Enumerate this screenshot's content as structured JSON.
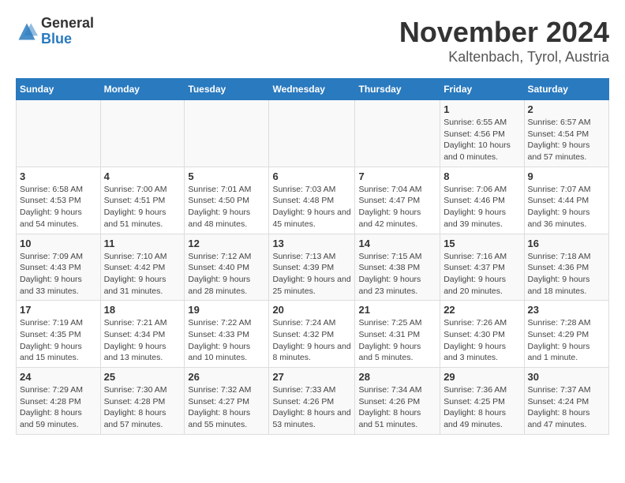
{
  "header": {
    "logo_general": "General",
    "logo_blue": "Blue",
    "month_title": "November 2024",
    "location": "Kaltenbach, Tyrol, Austria"
  },
  "weekdays": [
    "Sunday",
    "Monday",
    "Tuesday",
    "Wednesday",
    "Thursday",
    "Friday",
    "Saturday"
  ],
  "weeks": [
    [
      {
        "day": "",
        "info": ""
      },
      {
        "day": "",
        "info": ""
      },
      {
        "day": "",
        "info": ""
      },
      {
        "day": "",
        "info": ""
      },
      {
        "day": "",
        "info": ""
      },
      {
        "day": "1",
        "info": "Sunrise: 6:55 AM\nSunset: 4:56 PM\nDaylight: 10 hours and 0 minutes."
      },
      {
        "day": "2",
        "info": "Sunrise: 6:57 AM\nSunset: 4:54 PM\nDaylight: 9 hours and 57 minutes."
      }
    ],
    [
      {
        "day": "3",
        "info": "Sunrise: 6:58 AM\nSunset: 4:53 PM\nDaylight: 9 hours and 54 minutes."
      },
      {
        "day": "4",
        "info": "Sunrise: 7:00 AM\nSunset: 4:51 PM\nDaylight: 9 hours and 51 minutes."
      },
      {
        "day": "5",
        "info": "Sunrise: 7:01 AM\nSunset: 4:50 PM\nDaylight: 9 hours and 48 minutes."
      },
      {
        "day": "6",
        "info": "Sunrise: 7:03 AM\nSunset: 4:48 PM\nDaylight: 9 hours and 45 minutes."
      },
      {
        "day": "7",
        "info": "Sunrise: 7:04 AM\nSunset: 4:47 PM\nDaylight: 9 hours and 42 minutes."
      },
      {
        "day": "8",
        "info": "Sunrise: 7:06 AM\nSunset: 4:46 PM\nDaylight: 9 hours and 39 minutes."
      },
      {
        "day": "9",
        "info": "Sunrise: 7:07 AM\nSunset: 4:44 PM\nDaylight: 9 hours and 36 minutes."
      }
    ],
    [
      {
        "day": "10",
        "info": "Sunrise: 7:09 AM\nSunset: 4:43 PM\nDaylight: 9 hours and 33 minutes."
      },
      {
        "day": "11",
        "info": "Sunrise: 7:10 AM\nSunset: 4:42 PM\nDaylight: 9 hours and 31 minutes."
      },
      {
        "day": "12",
        "info": "Sunrise: 7:12 AM\nSunset: 4:40 PM\nDaylight: 9 hours and 28 minutes."
      },
      {
        "day": "13",
        "info": "Sunrise: 7:13 AM\nSunset: 4:39 PM\nDaylight: 9 hours and 25 minutes."
      },
      {
        "day": "14",
        "info": "Sunrise: 7:15 AM\nSunset: 4:38 PM\nDaylight: 9 hours and 23 minutes."
      },
      {
        "day": "15",
        "info": "Sunrise: 7:16 AM\nSunset: 4:37 PM\nDaylight: 9 hours and 20 minutes."
      },
      {
        "day": "16",
        "info": "Sunrise: 7:18 AM\nSunset: 4:36 PM\nDaylight: 9 hours and 18 minutes."
      }
    ],
    [
      {
        "day": "17",
        "info": "Sunrise: 7:19 AM\nSunset: 4:35 PM\nDaylight: 9 hours and 15 minutes."
      },
      {
        "day": "18",
        "info": "Sunrise: 7:21 AM\nSunset: 4:34 PM\nDaylight: 9 hours and 13 minutes."
      },
      {
        "day": "19",
        "info": "Sunrise: 7:22 AM\nSunset: 4:33 PM\nDaylight: 9 hours and 10 minutes."
      },
      {
        "day": "20",
        "info": "Sunrise: 7:24 AM\nSunset: 4:32 PM\nDaylight: 9 hours and 8 minutes."
      },
      {
        "day": "21",
        "info": "Sunrise: 7:25 AM\nSunset: 4:31 PM\nDaylight: 9 hours and 5 minutes."
      },
      {
        "day": "22",
        "info": "Sunrise: 7:26 AM\nSunset: 4:30 PM\nDaylight: 9 hours and 3 minutes."
      },
      {
        "day": "23",
        "info": "Sunrise: 7:28 AM\nSunset: 4:29 PM\nDaylight: 9 hours and 1 minute."
      }
    ],
    [
      {
        "day": "24",
        "info": "Sunrise: 7:29 AM\nSunset: 4:28 PM\nDaylight: 8 hours and 59 minutes."
      },
      {
        "day": "25",
        "info": "Sunrise: 7:30 AM\nSunset: 4:28 PM\nDaylight: 8 hours and 57 minutes."
      },
      {
        "day": "26",
        "info": "Sunrise: 7:32 AM\nSunset: 4:27 PM\nDaylight: 8 hours and 55 minutes."
      },
      {
        "day": "27",
        "info": "Sunrise: 7:33 AM\nSunset: 4:26 PM\nDaylight: 8 hours and 53 minutes."
      },
      {
        "day": "28",
        "info": "Sunrise: 7:34 AM\nSunset: 4:26 PM\nDaylight: 8 hours and 51 minutes."
      },
      {
        "day": "29",
        "info": "Sunrise: 7:36 AM\nSunset: 4:25 PM\nDaylight: 8 hours and 49 minutes."
      },
      {
        "day": "30",
        "info": "Sunrise: 7:37 AM\nSunset: 4:24 PM\nDaylight: 8 hours and 47 minutes."
      }
    ]
  ]
}
